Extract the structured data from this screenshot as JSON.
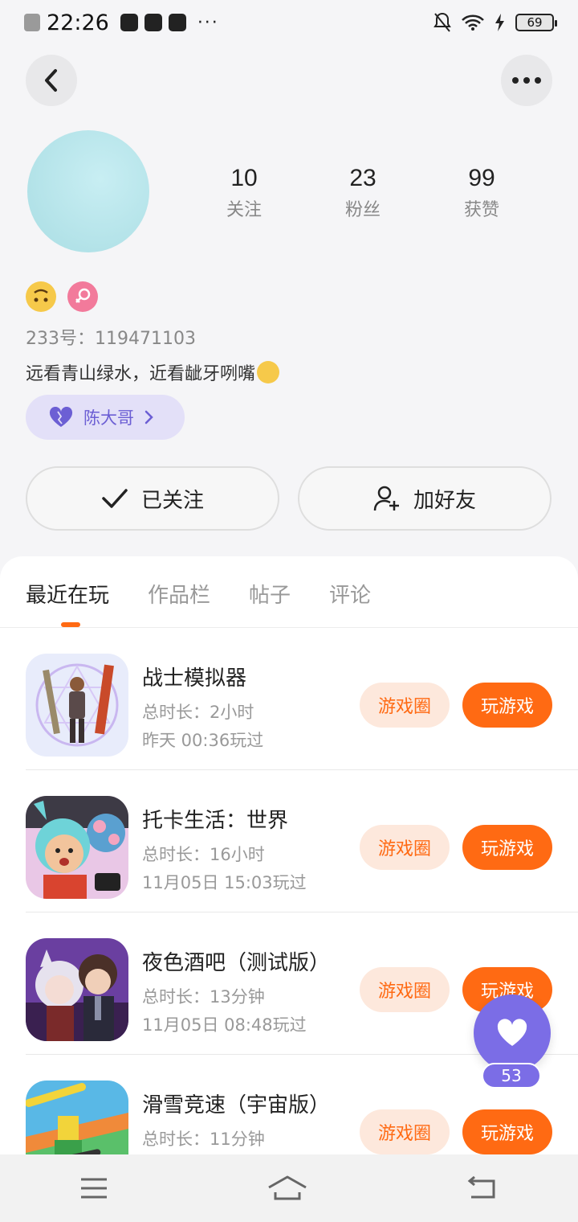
{
  "status_bar": {
    "time": "22:26",
    "dots": "···",
    "battery": "69"
  },
  "profile": {
    "stats": [
      {
        "num": "10",
        "label": "关注"
      },
      {
        "num": "23",
        "label": "粉丝"
      },
      {
        "num": "99",
        "label": "获赞"
      }
    ],
    "id_line": "233号：119471103",
    "bio": "远看青山绿水，近看龇牙咧嘴",
    "relation_label": "陈大哥",
    "follow_label": "已关注",
    "add_friend_label": "加好友"
  },
  "tabs": [
    "最近在玩",
    "作品栏",
    "帖子",
    "评论"
  ],
  "games": [
    {
      "title": "战士模拟器",
      "duration": "总时长：2小时",
      "last_played": "昨天 00:36玩过",
      "circle_label": "游戏圈",
      "play_label": "玩游戏"
    },
    {
      "title": "托卡生活：世界",
      "duration": "总时长：16小时",
      "last_played": "11月05日 15:03玩过",
      "circle_label": "游戏圈",
      "play_label": "玩游戏"
    },
    {
      "title": "夜色酒吧（测试版）",
      "duration": "总时长：13分钟",
      "last_played": "11月05日 08:48玩过",
      "circle_label": "游戏圈",
      "play_label": "玩游戏"
    },
    {
      "title": "滑雪竞速（宇宙版）",
      "duration": "总时长：11分钟",
      "last_played": "",
      "circle_label": "游戏圈",
      "play_label": "玩游戏"
    }
  ],
  "fab": {
    "count": "53"
  },
  "colors": {
    "accent": "#ff6a13",
    "purple": "#7b6de6",
    "pill_bg": "#e3e0f8"
  }
}
